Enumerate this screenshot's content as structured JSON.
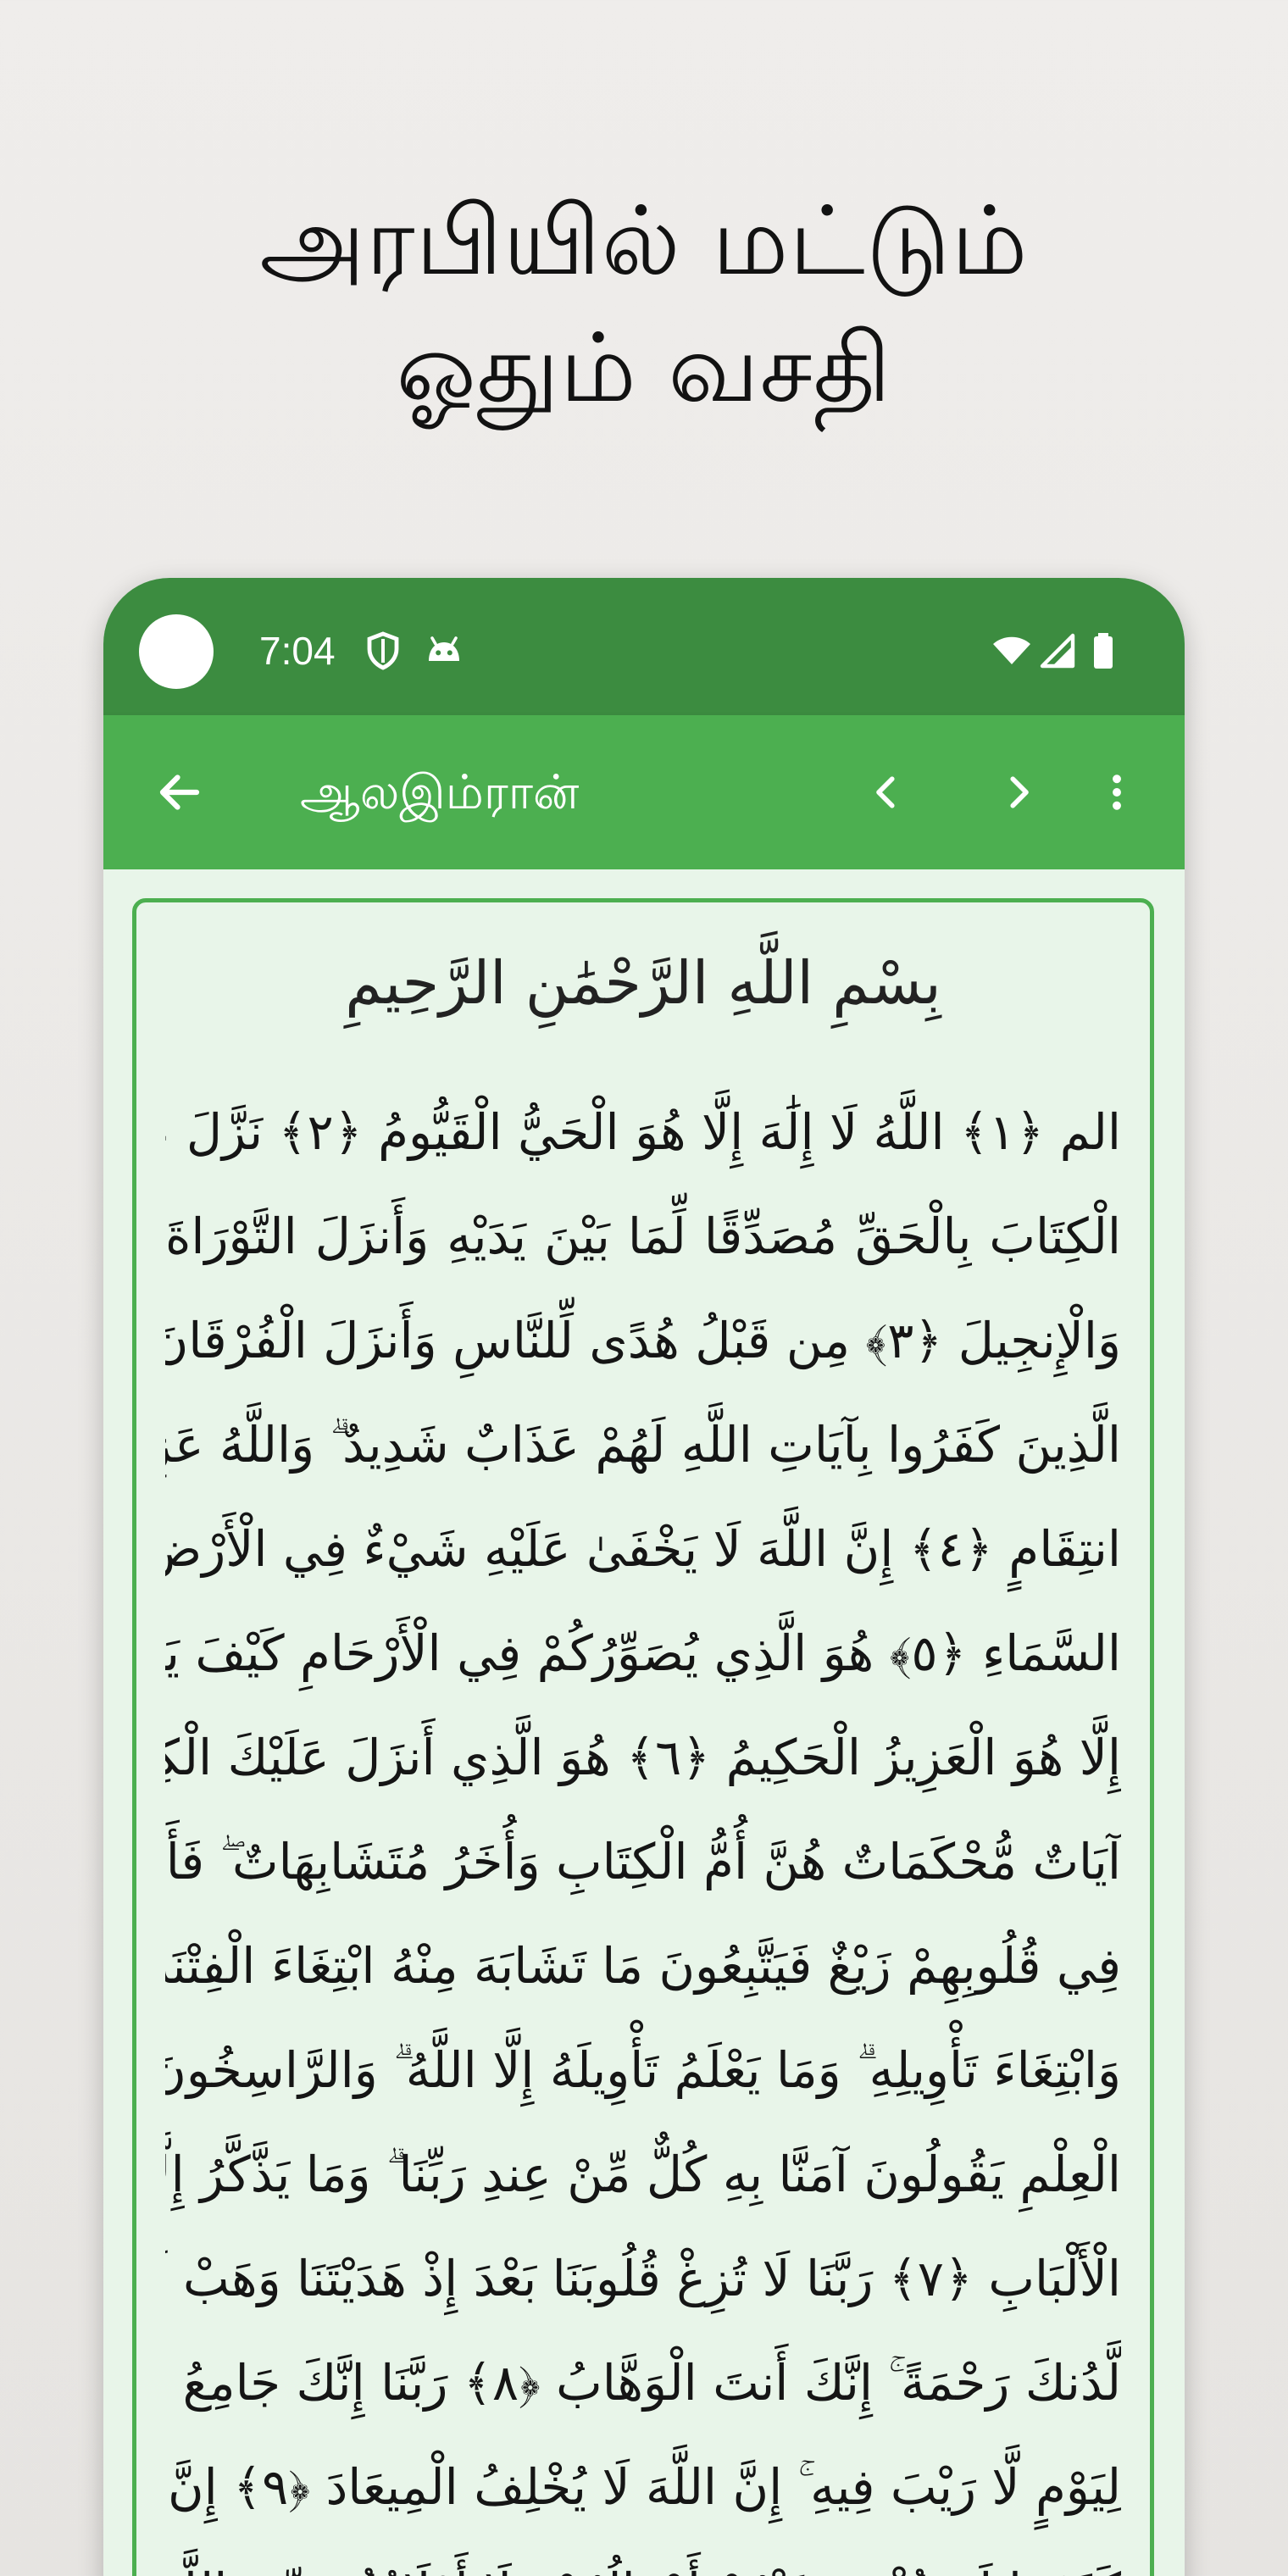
{
  "promo": {
    "title_line1": "அரபியில் மட்டும்",
    "title_line2": "ஓதும் வசதி"
  },
  "status_bar": {
    "time": "7:04",
    "left_icons": [
      "shield-icon",
      "android-icon"
    ],
    "right_icons": [
      "wifi-icon",
      "signal-icon",
      "battery-icon"
    ]
  },
  "app_bar": {
    "title": "ஆலஇம்ரான்",
    "back_icon": "arrow-left-icon",
    "prev_icon": "chevron-left-icon",
    "next_icon": "chevron-right-icon",
    "menu_icon": "more-vert-icon"
  },
  "colors": {
    "status_bar": "#3c8c40",
    "app_bar": "#4caf50",
    "content_bg": "#e8f5e9",
    "frame_border": "#4caf50"
  },
  "quran": {
    "basmala": "بِسْمِ اللَّهِ الرَّحْمَٰنِ الرَّحِيمِ",
    "lines": [
      "الم ﴿١﴾ اللَّهُ لَا إِلَٰهَ إِلَّا هُوَ الْحَيُّ الْقَيُّومُ ﴿٢﴾ نَزَّلَ عَلَيْكَ",
      "الْكِتَابَ بِالْحَقِّ مُصَدِّقًا لِّمَا بَيْنَ يَدَيْهِ وَأَنزَلَ التَّوْرَاةَ",
      "وَالْإِنجِيلَ ﴿٣﴾ مِن قَبْلُ هُدًى لِّلنَّاسِ وَأَنزَلَ الْفُرْقَانَ ۗ إِنَّ",
      "الَّذِينَ كَفَرُوا بِآيَاتِ اللَّهِ لَهُمْ عَذَابٌ شَدِيدٌ ۗ وَاللَّهُ عَزِيزٌ ذُو",
      "انتِقَامٍ ﴿٤﴾ إِنَّ اللَّهَ لَا يَخْفَىٰ عَلَيْهِ شَيْءٌ فِي الْأَرْضِ وَلَا فِي",
      "السَّمَاءِ ﴿٥﴾ هُوَ الَّذِي يُصَوِّرُكُمْ فِي الْأَرْحَامِ كَيْفَ يَشَاءُ ۚ لَا إِلَٰهَ",
      "إِلَّا هُوَ الْعَزِيزُ الْحَكِيمُ ﴿٦﴾ هُوَ الَّذِي أَنزَلَ عَلَيْكَ الْكِتَابَ مِنْهُ",
      "آيَاتٌ مُّحْكَمَاتٌ هُنَّ أُمُّ الْكِتَابِ وَأُخَرُ مُتَشَابِهَاتٌ ۖ فَأَمَّا الَّذِينَ",
      "فِي قُلُوبِهِمْ زَيْغٌ فَيَتَّبِعُونَ مَا تَشَابَهَ مِنْهُ ابْتِغَاءَ الْفِتْنَةِ",
      "وَابْتِغَاءَ تَأْوِيلِهِ ۗ وَمَا يَعْلَمُ تَأْوِيلَهُ إِلَّا اللَّهُ ۗ وَالرَّاسِخُونَ فِي",
      "الْعِلْمِ يَقُولُونَ آمَنَّا بِهِ كُلٌّ مِّنْ عِندِ رَبِّنَا ۗ وَمَا يَذَّكَّرُ إِلَّا أُولُو",
      "الْأَلْبَابِ ﴿٧﴾ رَبَّنَا لَا تُزِغْ قُلُوبَنَا بَعْدَ إِذْ هَدَيْتَنَا وَهَبْ لَنَا مِن",
      "لَّدُنكَ رَحْمَةً ۚ إِنَّكَ أَنتَ الْوَهَّابُ ﴿٨﴾ رَبَّنَا إِنَّكَ جَامِعُ النَّاسِ",
      "لِيَوْمٍ لَّا رَيْبَ فِيهِ ۚ إِنَّ اللَّهَ لَا يُخْلِفُ الْمِيعَادَ ﴿٩﴾ إِنَّ الَّذِينَ",
      "كَفَرُوا لَن تُغْنِيَ عَنْهُمْ أَمْوَالُهُمْ وَلَا أَوْلَادُهُم مِّنَ اللَّهِ شَيْئًا ۖ"
    ]
  }
}
